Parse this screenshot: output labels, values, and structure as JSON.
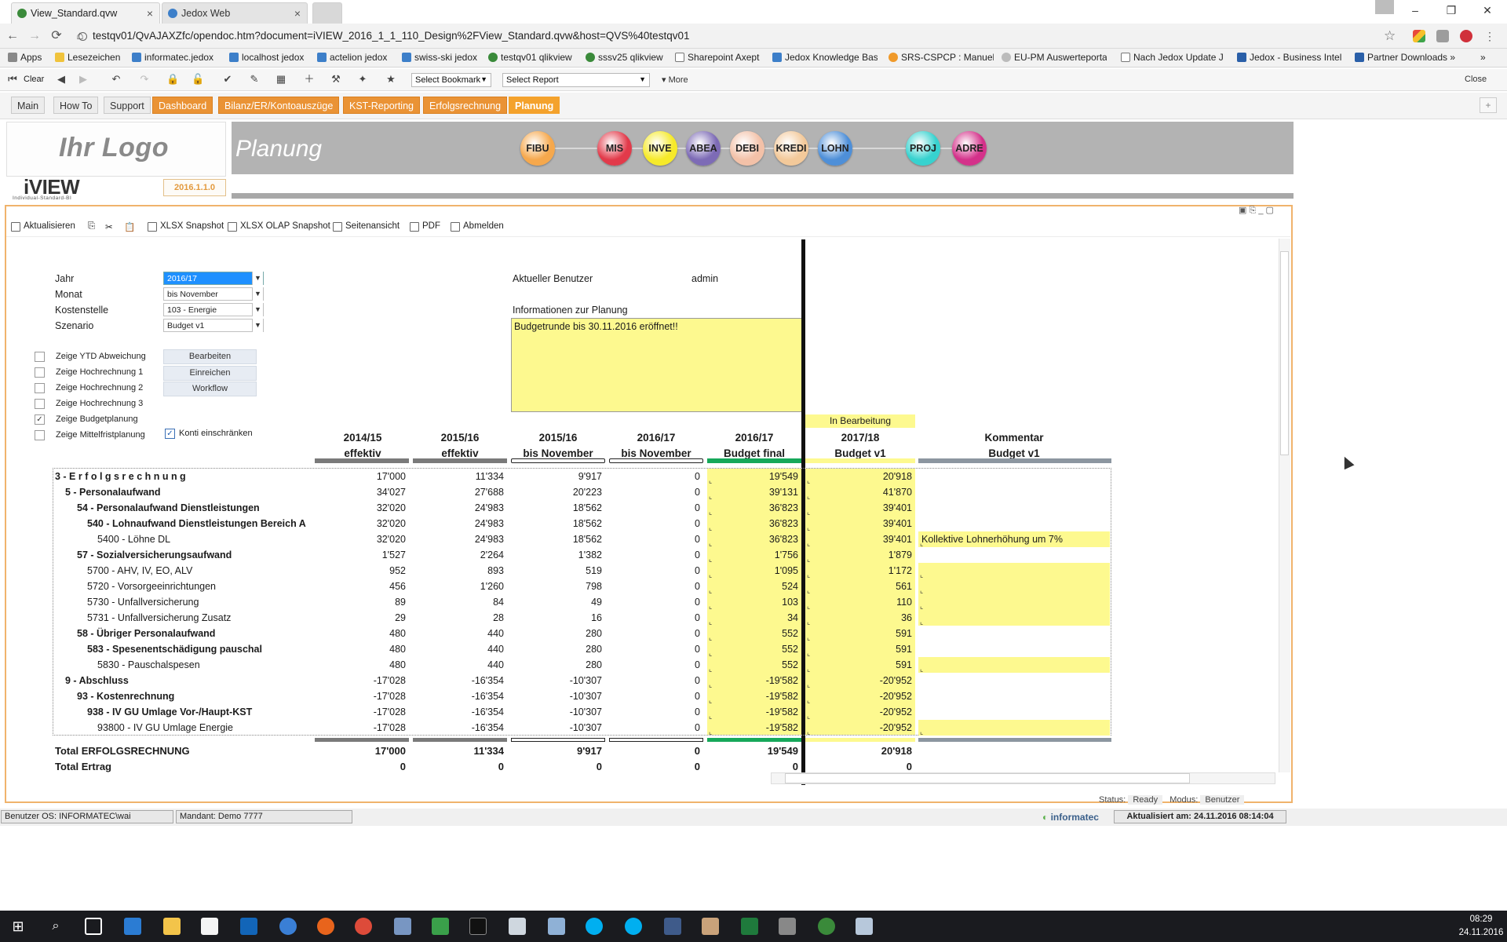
{
  "browser": {
    "tabs": [
      {
        "title": "View_Standard.qvw",
        "active": true
      },
      {
        "title": "Jedox Web",
        "active": false
      }
    ],
    "url": "testqv01/QvAJAXZfc/opendoc.htm?document=iVIEW_2016_1_1_110_Design%2FView_Standard.qvw&host=QVS%40testqv01",
    "bookmarks": [
      "Apps",
      "Lesezeichen",
      "informatec.jedox",
      "localhost jedox",
      "actelion jedox",
      "swiss-ski jedox",
      "testqv01 qlikview",
      "sssv25 qlikview",
      "Sharepoint Axept",
      "Jedox Knowledge Bas",
      "SRS-CSPCP : Manuel",
      "EU-PM Auswerteporta",
      "Nach Jedox Update Je",
      "Jedox - Business Intel",
      "Partner Downloads »"
    ],
    "more_bookmarks": "»"
  },
  "qv_toolbar": {
    "clear": "Clear",
    "bookmark_select": "Select Bookmark",
    "report_select": "Select Report",
    "more": "More",
    "close": "Close"
  },
  "sheet_tabs": [
    {
      "label": "Main",
      "style": "plain"
    },
    {
      "label": "How To",
      "style": "plain"
    },
    {
      "label": "Support",
      "style": "plain"
    },
    {
      "label": "Dashboard",
      "style": "orange"
    },
    {
      "label": "Bilanz/ER/Kontoauszüge",
      "style": "orange"
    },
    {
      "label": "KST-Reporting",
      "style": "orange"
    },
    {
      "label": "Erfolgsrechnung",
      "style": "orange"
    },
    {
      "label": "Planung",
      "style": "active"
    }
  ],
  "header": {
    "logo_text": "Ihr Logo",
    "title": "Planung",
    "iview": "iVIEW",
    "iview_sub": "Individual-Standard-BI",
    "version": "2016.1.1.0",
    "modules": [
      {
        "label": "FIBU",
        "color": "#f6a84c"
      },
      {
        "label": "MIS",
        "color": "#e23a4a"
      },
      {
        "label": "INVE",
        "color": "#f6ea2a"
      },
      {
        "label": "ABEA",
        "color": "#7d6bb6"
      },
      {
        "label": "DEBI",
        "color": "#f3c1a8"
      },
      {
        "label": "KREDI",
        "color": "#f3c99a"
      },
      {
        "label": "LOHN",
        "color": "#4e8fd8"
      },
      {
        "label": "PROJ",
        "color": "#37d2cf"
      },
      {
        "label": "ADRE",
        "color": "#d4318a"
      }
    ]
  },
  "actions": [
    "Aktualisieren",
    "XLSX Snapshot",
    "XLSX OLAP Snapshot",
    "Seitenansicht",
    "PDF",
    "Abmelden"
  ],
  "filters": [
    {
      "label": "Jahr",
      "value": "2016/17",
      "selected": true
    },
    {
      "label": "Monat",
      "value": "bis November",
      "selected": false
    },
    {
      "label": "Kostenstelle",
      "value": "103 - Energie",
      "selected": false
    },
    {
      "label": "Szenario",
      "value": "Budget v1",
      "selected": false
    }
  ],
  "checkboxes": [
    {
      "label": "Zeige YTD Abweichung",
      "checked": false
    },
    {
      "label": "Zeige Hochrechnung 1",
      "checked": false
    },
    {
      "label": "Zeige Hochrechnung 2",
      "checked": false
    },
    {
      "label": "Zeige Hochrechnung 3",
      "checked": false
    },
    {
      "label": "Zeige Budgetplanung",
      "checked": true
    },
    {
      "label": "Zeige Mittelfristplanung",
      "checked": false
    }
  ],
  "side_buttons": [
    "Bearbeiten",
    "Einreichen",
    "Workflow"
  ],
  "konti": {
    "label": "Konti einschränken",
    "checked": true
  },
  "user": {
    "label": "Aktueller Benutzer",
    "value": "admin"
  },
  "info": {
    "label": "Informationen zur Planung",
    "text": "Budgetrunde bis 30.11.2016 eröffnet!!"
  },
  "status_chip": "In Bearbeitung",
  "columns": [
    {
      "l1": "2014/15",
      "l2": "effektiv"
    },
    {
      "l1": "2015/16",
      "l2": "effektiv"
    },
    {
      "l1": "2015/16",
      "l2": "bis November"
    },
    {
      "l1": "2016/17",
      "l2": "bis November"
    },
    {
      "l1": "2016/17",
      "l2": "Budget final"
    },
    {
      "l1": "2017/18",
      "l2": "Budget v1"
    },
    {
      "l1": "Kommentar",
      "l2": "Budget v1"
    }
  ],
  "rows": [
    {
      "label": "3 - E r f o l g s r e c h n u n g",
      "indent": 0,
      "bold": true,
      "v": [
        "17'000",
        "11'334",
        "9'917",
        "0",
        "19'549",
        "20'918"
      ],
      "komm": null
    },
    {
      "label": "5 - Personalaufwand",
      "indent": 1,
      "bold": true,
      "v": [
        "34'027",
        "27'688",
        "20'223",
        "0",
        "39'131",
        "41'870"
      ],
      "komm": null
    },
    {
      "label": "54 - Personalaufwand Dienstleistungen",
      "indent": 2,
      "bold": true,
      "v": [
        "32'020",
        "24'983",
        "18'562",
        "0",
        "36'823",
        "39'401"
      ],
      "komm": null
    },
    {
      "label": "540 - Lohnaufwand Dienstleistungen Bereich A",
      "indent": 3,
      "bold": true,
      "v": [
        "32'020",
        "24'983",
        "18'562",
        "0",
        "36'823",
        "39'401"
      ],
      "komm": null
    },
    {
      "label": "5400 - Löhne DL",
      "indent": 4,
      "bold": false,
      "v": [
        "32'020",
        "24'983",
        "18'562",
        "0",
        "36'823",
        "39'401"
      ],
      "komm": "Kollektive Lohnerhöhung um 7%"
    },
    {
      "label": "57 - Sozialversicherungsaufwand",
      "indent": 2,
      "bold": true,
      "v": [
        "1'527",
        "2'264",
        "1'382",
        "0",
        "1'756",
        "1'879"
      ],
      "komm": null
    },
    {
      "label": "5700 - AHV, IV, EO, ALV",
      "indent": 3,
      "bold": false,
      "v": [
        "952",
        "893",
        "519",
        "0",
        "1'095",
        "1'172"
      ],
      "komm": ""
    },
    {
      "label": "5720 - Vorsorgeeinrichtungen",
      "indent": 3,
      "bold": false,
      "v": [
        "456",
        "1'260",
        "798",
        "0",
        "524",
        "561"
      ],
      "komm": ""
    },
    {
      "label": "5730 - Unfallversicherung",
      "indent": 3,
      "bold": false,
      "v": [
        "89",
        "84",
        "49",
        "0",
        "103",
        "110"
      ],
      "komm": ""
    },
    {
      "label": "5731 - Unfallversicherung Zusatz",
      "indent": 3,
      "bold": false,
      "v": [
        "29",
        "28",
        "16",
        "0",
        "34",
        "36"
      ],
      "komm": ""
    },
    {
      "label": "58 - Übriger Personalaufwand",
      "indent": 2,
      "bold": true,
      "v": [
        "480",
        "440",
        "280",
        "0",
        "552",
        "591"
      ],
      "komm": null
    },
    {
      "label": "583 - Spesenentschädigung pauschal",
      "indent": 3,
      "bold": true,
      "v": [
        "480",
        "440",
        "280",
        "0",
        "552",
        "591"
      ],
      "komm": null
    },
    {
      "label": "5830 - Pauschalspesen",
      "indent": 4,
      "bold": false,
      "v": [
        "480",
        "440",
        "280",
        "0",
        "552",
        "591"
      ],
      "komm": ""
    },
    {
      "label": "9 - Abschluss",
      "indent": 1,
      "bold": true,
      "v": [
        "-17'028",
        "-16'354",
        "-10'307",
        "0",
        "-19'582",
        "-20'952"
      ],
      "komm": null
    },
    {
      "label": "93 - Kostenrechnung",
      "indent": 2,
      "bold": true,
      "v": [
        "-17'028",
        "-16'354",
        "-10'307",
        "0",
        "-19'582",
        "-20'952"
      ],
      "komm": null
    },
    {
      "label": "938 - IV GU Umlage Vor-/Haupt-KST",
      "indent": 3,
      "bold": true,
      "v": [
        "-17'028",
        "-16'354",
        "-10'307",
        "0",
        "-19'582",
        "-20'952"
      ],
      "komm": null
    },
    {
      "label": "93800 - IV GU Umlage Energie",
      "indent": 4,
      "bold": false,
      "v": [
        "-17'028",
        "-16'354",
        "-10'307",
        "0",
        "-19'582",
        "-20'952"
      ],
      "komm": ""
    }
  ],
  "totals": [
    {
      "label": "Total ERFOLGSRECHNUNG",
      "v": [
        "17'000",
        "11'334",
        "9'917",
        "0",
        "19'549",
        "20'918"
      ]
    },
    {
      "label": "Total Ertrag",
      "v": [
        "0",
        "0",
        "0",
        "0",
        "0",
        "0"
      ]
    }
  ],
  "inner_status": {
    "status_label": "Status:",
    "status_value": "Ready",
    "mode_label": "Modus:",
    "mode_value": "Benutzer"
  },
  "statusbar": {
    "os_user": "Benutzer OS: INFORMATEC\\wai",
    "mandant": "Mandant: Demo 7777",
    "brand": "informatec",
    "updated": "Aktualisiert am: 24.11.2016 08:14:04"
  },
  "clock": {
    "time": "08:29",
    "date": "24.11.2016"
  }
}
